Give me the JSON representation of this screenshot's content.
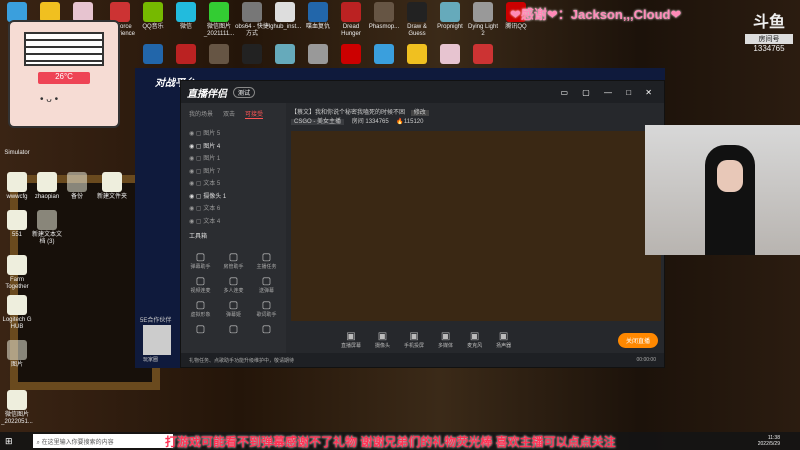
{
  "desktop": {
    "top_row": [
      "",
      "",
      "",
      "GeForce Experience",
      "QQ音乐",
      "微信",
      "微信图片_2021111...",
      "obs64 - 快捷方式",
      "lghub_inst...",
      "喋血复仇",
      "Dread Hunger",
      "Phasmop...",
      "Draw & Guess",
      "Propnight",
      "Dying Light 2",
      "腾讯QQ"
    ],
    "left_icons": [
      "Simulator",
      "wwwcfg",
      "zhaopian",
      "备份",
      "新建文件夹",
      "551",
      "新建文本文档 (3)",
      "Farm Together",
      "Logitech G HUB",
      "图片",
      "微信图片_2022051..."
    ]
  },
  "overlay": {
    "temperature": "26°C",
    "thanks": "❤感谢❤：Jackson,,,Cloud❤",
    "platform": "斗鱼",
    "room_label": "房间号",
    "room_number": "1334765",
    "subtitle": "打游戏可能看不到弹幕感谢不了礼物 谢谢兄弟们的礼物荧光棒  喜欢主播可以点点关注"
  },
  "app5e": {
    "title": "对战平台"
  },
  "app": {
    "title": "直播伴侣",
    "beta": "测试",
    "stream_title": "【蔡文】我和你说个秘密我嗑死的时候不困",
    "edit": "修改",
    "category": "CSGO - 美女主播",
    "room": "房间 1334765",
    "heat": "115120",
    "tabs": [
      "我的场景",
      "双击",
      "可接受"
    ],
    "layers": [
      {
        "name": "图片 5",
        "visible": false
      },
      {
        "name": "图片 4",
        "visible": true
      },
      {
        "name": "图片 1",
        "visible": false
      },
      {
        "name": "图片 7",
        "visible": false
      },
      {
        "name": "文本 5",
        "visible": false
      },
      {
        "name": "摄像头 1",
        "visible": true
      },
      {
        "name": "文本 6",
        "visible": false
      },
      {
        "name": "文本 4",
        "visible": false
      }
    ],
    "toolbox": "工具箱",
    "tools": [
      "弹幕助手",
      "房管助手",
      "主播任务",
      "视频连麦",
      "多人连麦",
      "送弹幕",
      "虚拟形象",
      "弹幕姬",
      "歌词助手",
      "",
      "",
      ""
    ],
    "partner": "5E合作伙伴",
    "partner_name": "玩家圈",
    "controls": [
      "直播屏幕",
      "摄像头",
      "手机投屏",
      "多媒体",
      "麦克风",
      "扬声器"
    ],
    "go_live": "关闭直播",
    "notice": "礼物任务、点歌助手功能升级维护中，敬请期待",
    "timer": "00:00:00"
  },
  "taskbar": {
    "search_placeholder": "在这里输入你要搜索的内容",
    "time": "11:38",
    "date": "2022/5/29"
  }
}
